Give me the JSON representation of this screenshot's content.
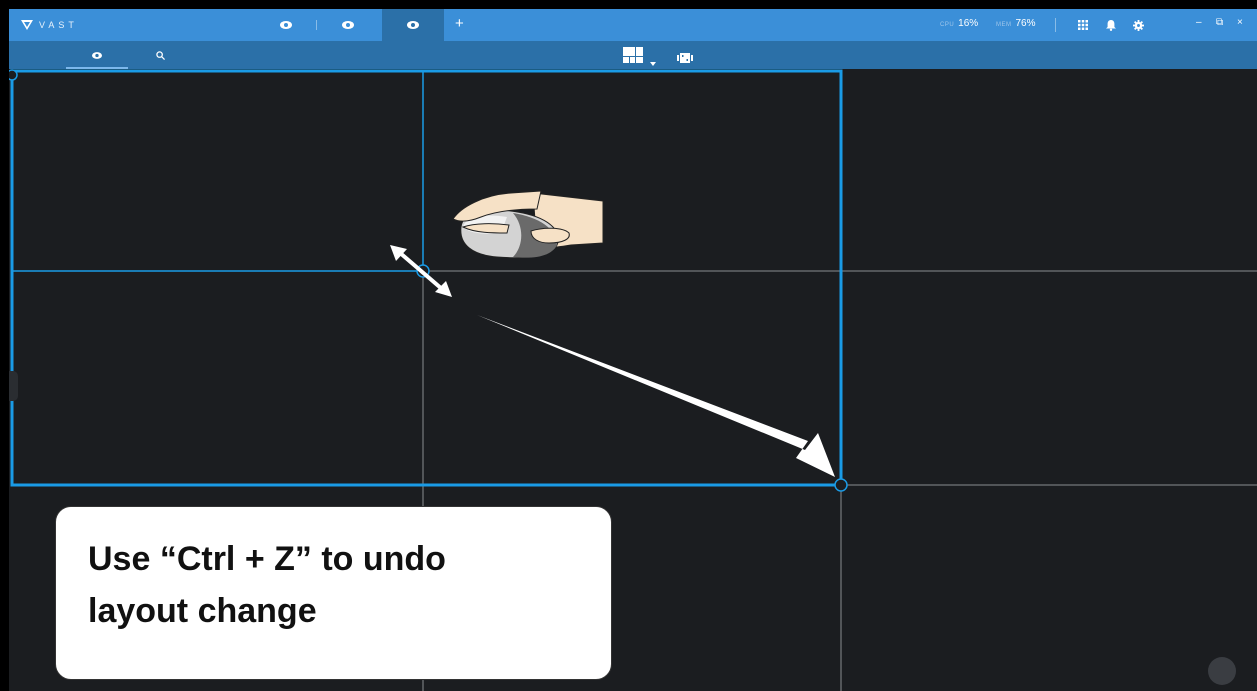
{
  "app": {
    "logo_text": "VAST",
    "tabs": [
      {
        "icon": "eye-icon",
        "active": false
      },
      {
        "icon": "eye-icon",
        "active": false
      },
      {
        "icon": "eye-icon",
        "active": true
      }
    ],
    "add_tab_label": "+"
  },
  "status": {
    "cpu_label": "CPU",
    "cpu_value": "16%",
    "mem_label": "MEM",
    "mem_value": "76%"
  },
  "toolbar_icons": [
    "grid-menu-icon",
    "bell-icon",
    "gear-icon"
  ],
  "window_controls": {
    "minimize": "–",
    "restore": "⧉",
    "close": "×"
  },
  "subtabs": [
    {
      "icon": "eye-icon",
      "active": true
    },
    {
      "icon": "search-icon",
      "active": false
    }
  ],
  "layout_controls": [
    "layout-grid-icon",
    "chevron-down-icon",
    "filmstrip-icon"
  ],
  "instruction": {
    "line1": "Use “Ctrl + Z” to undo",
    "line2": "layout change"
  },
  "colors": {
    "titlebar": "#3b8fd8",
    "toolbar": "#2b70a8",
    "canvas": "#1b1d20",
    "selection": "#1a9be6",
    "gridline": "#8a8d91"
  }
}
